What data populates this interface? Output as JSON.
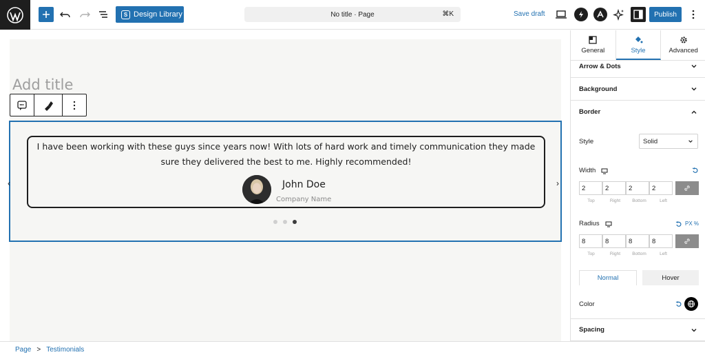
{
  "topbar": {
    "design_library_label": "Design Library",
    "document_title": "No title · Page",
    "shortcut": "⌘K",
    "save_draft_label": "Save draft",
    "publish_label": "Publish"
  },
  "editor": {
    "title_placeholder": "Add title",
    "testimonial": {
      "quote": "I have been working with these guys since years now! With lots of hard work and timely communication they made sure they delivered the best to me. Highly recommended!",
      "author_name": "John Doe",
      "company": "Company Name",
      "dots": [
        false,
        false,
        true
      ]
    }
  },
  "breadcrumb": {
    "items": [
      "Page",
      "Testimonials"
    ],
    "separator": ">"
  },
  "sidebar": {
    "tabs": [
      {
        "label": "General",
        "icon": "layout-icon",
        "active": false
      },
      {
        "label": "Style",
        "icon": "paint-bucket-icon",
        "active": true
      },
      {
        "label": "Advanced",
        "icon": "gear-icon",
        "active": false
      }
    ],
    "sections": {
      "arrow_dots": "Arrow & Dots",
      "background": "Background",
      "border": "Border",
      "spacing": "Spacing"
    },
    "border": {
      "style_label": "Style",
      "style_value": "Solid",
      "width_label": "Width",
      "width_values": [
        "2",
        "2",
        "2",
        "2"
      ],
      "radius_label": "Radius",
      "radius_values": [
        "8",
        "8",
        "8",
        "8"
      ],
      "radius_units": "PX  %",
      "side_labels": [
        "Top",
        "Right",
        "Bottom",
        "Left"
      ],
      "state_tabs": [
        "Normal",
        "Hover"
      ],
      "color_label": "Color"
    }
  },
  "colors": {
    "accent": "#2271b1",
    "dark": "#1e1e1e",
    "canvas_bg": "#f6f6f4"
  }
}
